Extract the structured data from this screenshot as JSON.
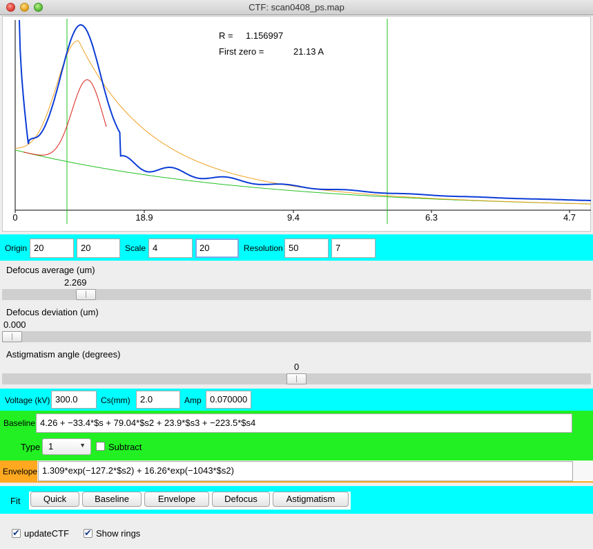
{
  "window": {
    "title": "CTF: scan0408_ps.map"
  },
  "plot": {
    "annotation": {
      "r_label": "R =",
      "r_value": "1.156997",
      "zero_label": "First zero =",
      "zero_value": "21.13 A"
    },
    "x_ticks": [
      "0",
      "18.9",
      "9.4",
      "6.3",
      "4.7"
    ],
    "colors": {
      "data": "#0a3cd6",
      "fit": "#d81e10",
      "envelope": "#f0a020",
      "baseline": "#22c022",
      "markers": "#22c022"
    }
  },
  "params": {
    "origin_label": "Origin",
    "origin_x": "20",
    "origin_y": "20",
    "scale_label": "Scale",
    "scale_x": "4",
    "scale_y": "20",
    "resolution_label": "Resolution",
    "resolution_a": "50",
    "resolution_b": "7"
  },
  "defocus_avg": {
    "label": "Defocus average (um)",
    "value": "2.269",
    "fraction": 0.13
  },
  "defocus_dev": {
    "label": "Defocus deviation (um)",
    "value": "0.000",
    "fraction": 0.0
  },
  "astig": {
    "label": "Astigmatism angle (degrees)",
    "value": "0",
    "fraction": 0.5
  },
  "microscope": {
    "voltage_label": "Voltage (kV)",
    "voltage": "300.0",
    "cs_label": "Cs(mm)",
    "cs": "2.0",
    "amp_label": "Amp",
    "amp": "0.070000"
  },
  "baseline": {
    "label": "Baseline",
    "expr": "4.26 + −33.4*$s + 79.04*$s2 + 23.9*$s3 + −223.5*$s4",
    "type_label": "Type",
    "type_value": "1",
    "subtract_label": "Subtract"
  },
  "envelope": {
    "label": "Envelope",
    "expr": "1.309*exp(−127.2*$s2) + 16.26*exp(−1043*$s2)"
  },
  "fit": {
    "label": "Fit",
    "buttons": [
      "Quick",
      "Baseline",
      "Envelope",
      "Defocus",
      "Astigmatism"
    ]
  },
  "options": {
    "update_ctf": "updateCTF",
    "show_rings": "Show rings"
  }
}
